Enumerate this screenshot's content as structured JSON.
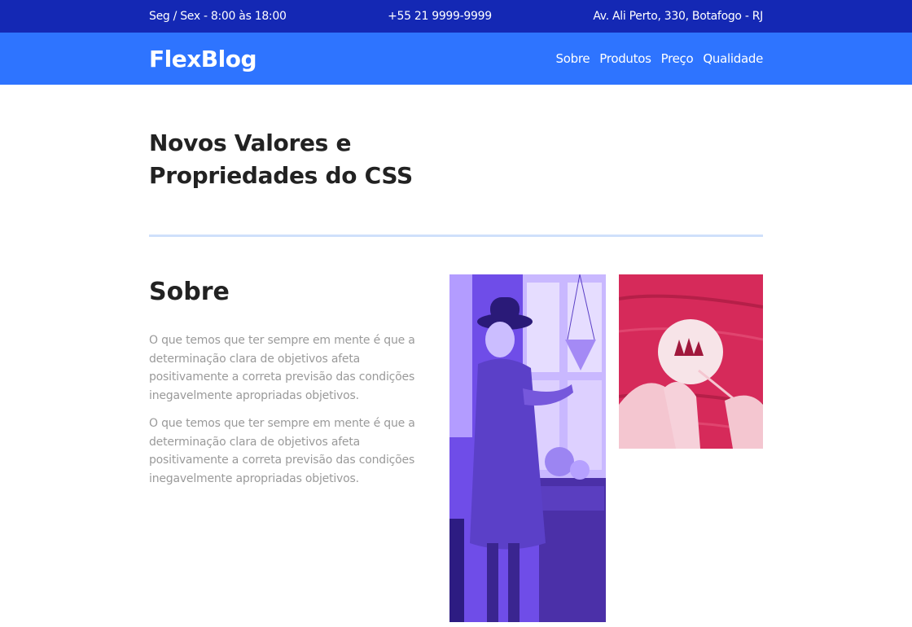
{
  "topbar": {
    "hours": "Seg / Sex - 8:00 às 18:00",
    "phone": "+55 21 9999-9999",
    "address": "Av. Ali Perto, 330, Botafogo - RJ"
  },
  "header": {
    "logo": "FlexBlog",
    "nav": [
      "Sobre",
      "Produtos",
      "Preço",
      "Qualidade"
    ]
  },
  "main": {
    "title": "Novos Valores e Propriedades do CSS",
    "about": {
      "heading": "Sobre",
      "paragraphs": [
        "O que temos que ter sempre em mente é que a determinação clara de objetivos afeta positivamente a correta previsão das condições inegavelmente apropriadas objetivos.",
        "O que temos que ter sempre em mente é que a determinação clara de objetivos afeta positivamente a correta previsão das condições inegavelmente apropriadas objetivos."
      ]
    }
  },
  "colors": {
    "topbar": "#1428b4",
    "header": "#2e74ff",
    "divider": "#cfe0fb",
    "photo_purple": "#6f4de8",
    "photo_red": "#d62a5a"
  }
}
